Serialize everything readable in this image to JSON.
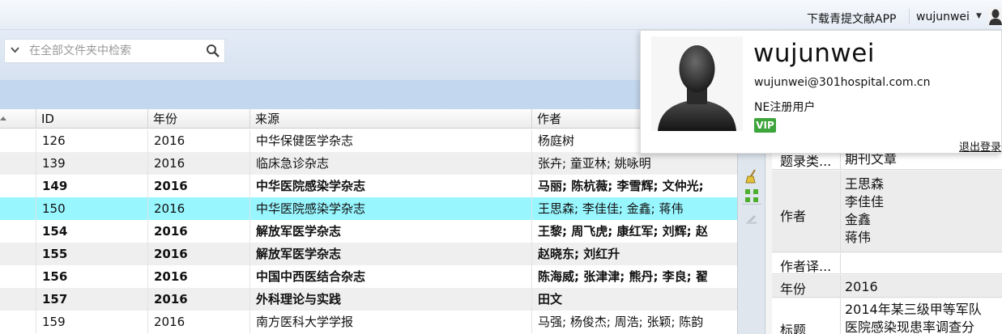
{
  "topbar": {
    "download_app": "下载青提文献APP",
    "username": "wujunwei"
  },
  "search": {
    "placeholder": "在全部文件夹中检索"
  },
  "table": {
    "headers": {
      "id": "ID",
      "year": "年份",
      "source": "来源",
      "author": "作者"
    },
    "rows": [
      {
        "id": "126",
        "year": "2016",
        "source": "中华保健医学杂志",
        "author": "杨庭树",
        "bold": false,
        "selected": false
      },
      {
        "id": "139",
        "year": "2016",
        "source": "临床急诊杂志",
        "author": "张卉; 童亚林; 姚咏明",
        "bold": false,
        "selected": false
      },
      {
        "id": "149",
        "year": "2016",
        "source": "中华医院感染学杂志",
        "author": "马丽; 陈杭薇; 李雪辉; 文仲光;",
        "bold": true,
        "selected": false
      },
      {
        "id": "150",
        "year": "2016",
        "source": "中华医院感染学杂志",
        "author": "王思森; 李佳佳; 金鑫; 蒋伟",
        "bold": false,
        "selected": true
      },
      {
        "id": "154",
        "year": "2016",
        "source": "解放军医学杂志",
        "author": "王黎; 周飞虎; 康红军; 刘辉; 赵",
        "bold": true,
        "selected": false
      },
      {
        "id": "155",
        "year": "2016",
        "source": "解放军医学杂志",
        "author": "赵晓东; 刘红升",
        "bold": true,
        "selected": false
      },
      {
        "id": "156",
        "year": "2016",
        "source": "中国中西医结合杂志",
        "author": "陈海威; 张津津; 熊丹; 李良; 翟",
        "bold": true,
        "selected": false
      },
      {
        "id": "157",
        "year": "2016",
        "source": "外科理论与实践",
        "author": "田文",
        "bold": true,
        "selected": false
      },
      {
        "id": "159",
        "year": "2016",
        "source": "南方医科大学学报",
        "author": "马强; 杨俊杰; 周浩; 张颖; 陈韵",
        "bold": false,
        "selected": false
      }
    ]
  },
  "detail": {
    "type_label": "题录类...",
    "type_value": "期刊文章",
    "author_label": "作者",
    "authors": [
      "王思森",
      "李佳佳",
      "金鑫",
      "蒋伟"
    ],
    "author_trans_label": "作者译...",
    "year_label": "年份",
    "year_value": "2016",
    "title_label": "标题",
    "title_line1": "2014年某三级甲等军队",
    "title_line2": "医院感染现患率调查分"
  },
  "popup": {
    "name": "wujunwei",
    "email": "wujunwei@301hospital.com.cn",
    "role": "NE注册用户",
    "badge": "VIP",
    "logout": "退出登录"
  },
  "colors": {
    "selected_row": "#98f6ff",
    "band": "#c3d7ee",
    "vip_green": "#3da53b"
  }
}
